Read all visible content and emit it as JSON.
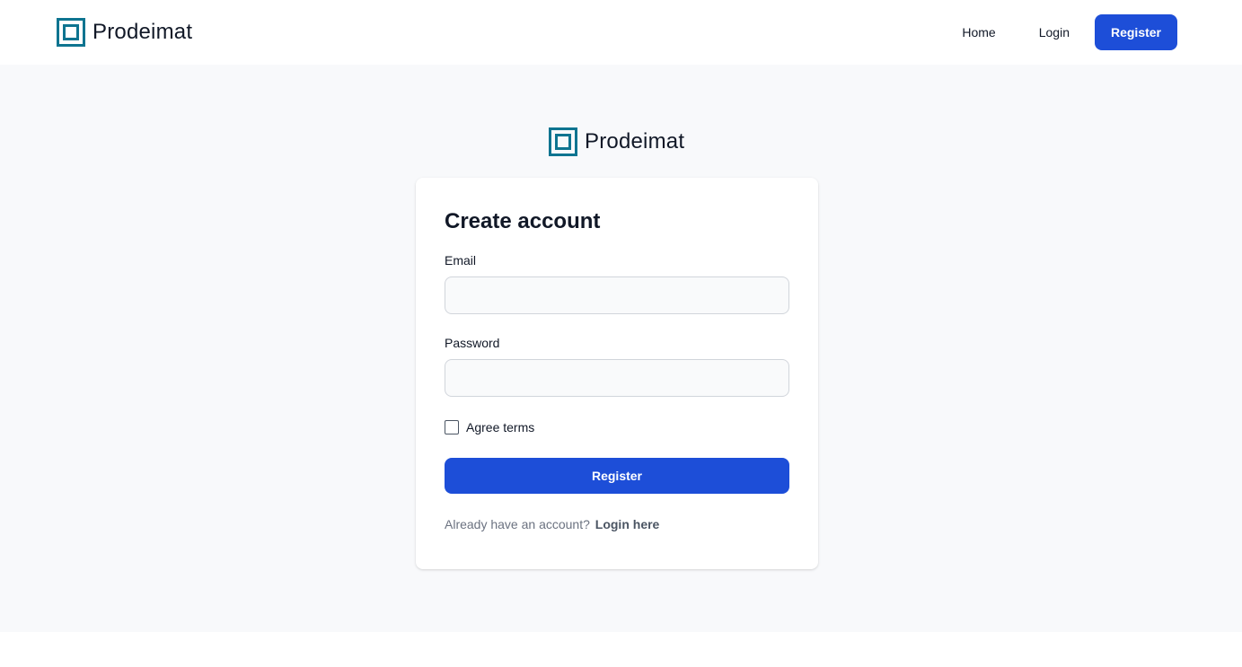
{
  "brand": {
    "name": "Prodeimat",
    "logo_icon": "square-frame-logo-icon",
    "logo_color": "#0e7490"
  },
  "nav": {
    "home_label": "Home",
    "login_label": "Login",
    "register_label": "Register"
  },
  "form": {
    "title": "Create account",
    "email_label": "Email",
    "email_value": "",
    "password_label": "Password",
    "password_value": "",
    "terms_label": "Agree terms",
    "terms_checked": false,
    "submit_label": "Register",
    "login_prompt": "Already have an account?",
    "login_link_label": "Login here"
  },
  "colors": {
    "accent": "#1d4ed8",
    "background": "#f8f9fb",
    "card": "#ffffff"
  }
}
